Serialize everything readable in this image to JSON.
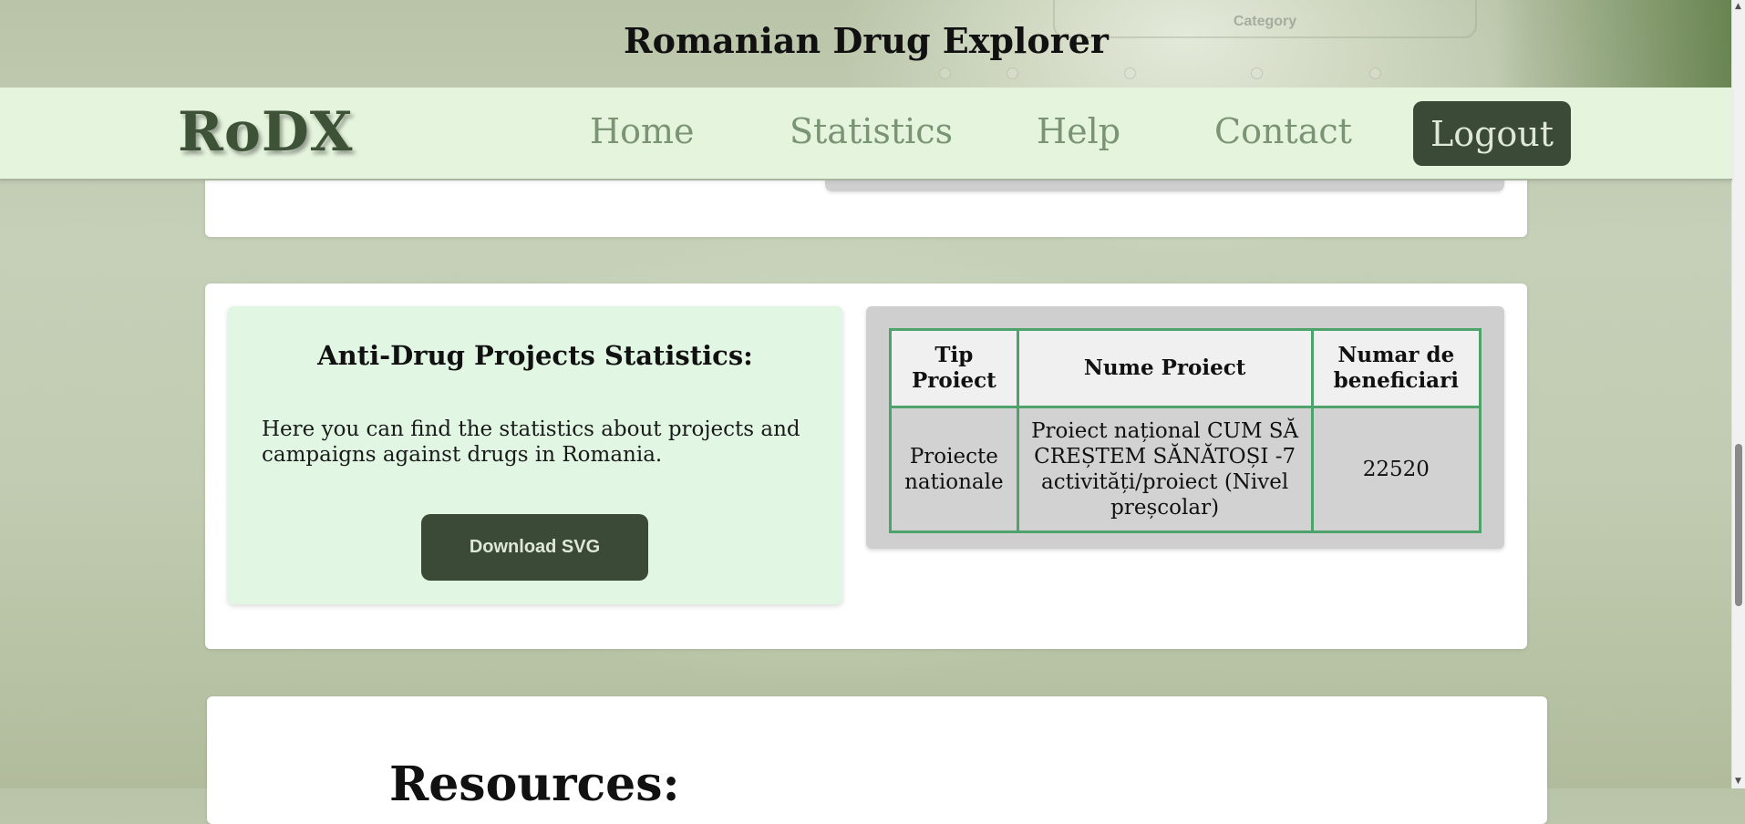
{
  "app": {
    "title": "Romanian Drug Explorer",
    "ghost_category_label": "Category"
  },
  "nav": {
    "logo": "RoDX",
    "items": [
      {
        "label": "Home"
      },
      {
        "label": "Statistics"
      },
      {
        "label": "Help"
      },
      {
        "label": "Contact"
      }
    ],
    "logout_label": "Logout"
  },
  "stats_section": {
    "heading": "Anti-Drug Projects Statistics:",
    "description": "Here you can find the statistics about projects and campaigns against drugs in Romania.",
    "download_label": "Download SVG",
    "table": {
      "headers": [
        "Tip Proiect",
        "Nume Proiect",
        "Numar de beneficiari"
      ],
      "rows": [
        [
          "Proiecte nationale",
          "Proiect național CUM SĂ CREȘTEM SĂNĂTOȘI -7 activități/proiect (Nivel preșcolar)",
          "22520"
        ]
      ]
    }
  },
  "resources": {
    "heading": "Resources:"
  },
  "colors": {
    "brand_dark": "#3a4a36",
    "nav_bg": "#e5f4dd",
    "panel_green": "#e1f7e3",
    "table_border": "#4ea36a"
  }
}
